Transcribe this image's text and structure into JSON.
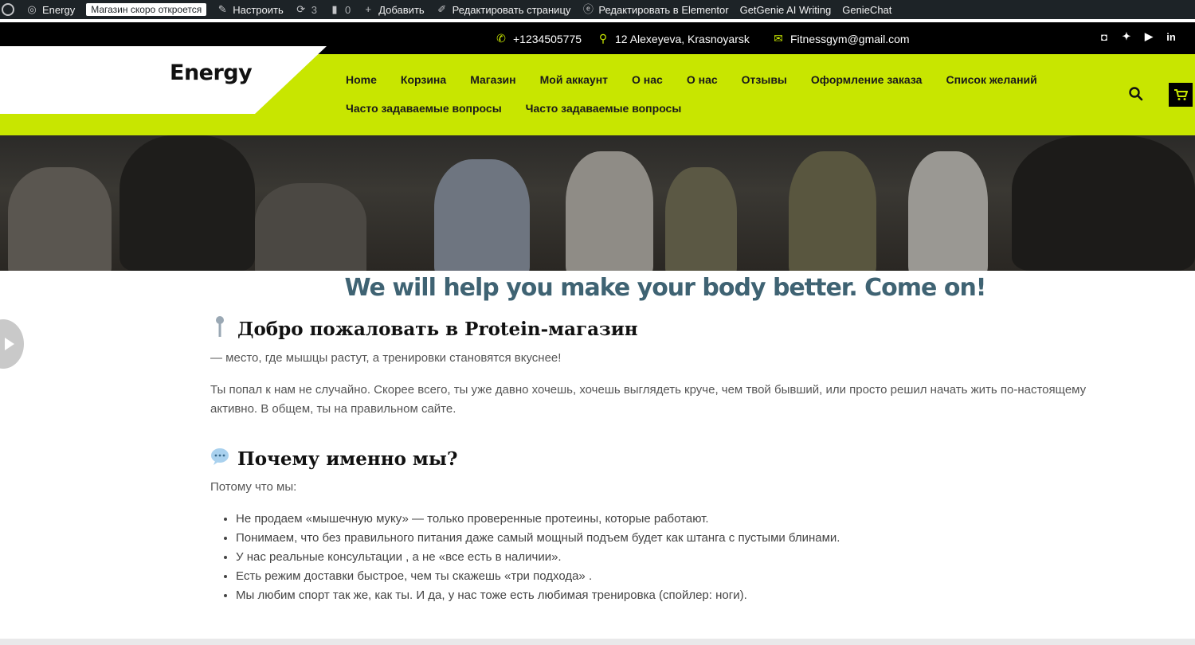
{
  "admin_bar": {
    "site_name": "Energy",
    "badge": "Магазин скоро откроется",
    "customize": "Настроить",
    "updates_count": "3",
    "comments_count": "0",
    "add_new": "Добавить",
    "edit_page": "Редактировать страницу",
    "elementor": "Редактировать в Elementor",
    "getgenie": "GetGenie AI Writing",
    "genie_chat": "GenieChat"
  },
  "top_bar": {
    "phone": "+1234505775",
    "address": "12 Alexeyeva, Krasnoyarsk",
    "email": "Fitnessgym@gmail.com"
  },
  "header": {
    "logo": "Energy",
    "nav": [
      "Home",
      "Корзина",
      "Магазин",
      "Мой аккаунт",
      "О нас",
      "О нас",
      "Отзывы",
      "Оформление заказа",
      "Список желаний",
      "Часто задаваемые вопросы",
      "Часто задаваемые вопросы"
    ]
  },
  "content": {
    "banner": "We will help you make your body better. Come on!",
    "welcome_title": "Добро пожаловать в Protein-магазин",
    "welcome_sub": "— место, где мышцы растут, а тренировки становятся вкуснее!",
    "intro": "Ты попал к нам не случайно. Скорее всего, ты уже давно хочешь, хочешь выглядеть круче, чем твой бывший, или просто решил начать жить по-настоящему активно. В общем, ты на правильном сайте.",
    "why_title": "Почему именно мы?",
    "because": "Потому что мы:",
    "bullets": [
      "Не продаем «мышечную муку» — только проверенные протеины, которые работают.",
      "Понимаем, что без правильного питания даже самый мощный подъем будет как штанга с пустыми блинами.",
      "У нас реальные консультации , а не «все есть в наличии».",
      "Есть режим доставки быстрое, чем ты скажешь «три подхода» .",
      "Мы любим спорт так же, как ты. И да, у нас тоже есть любимая тренировка (спойлер: ноги)."
    ]
  },
  "colors": {
    "accent": "#c8e600",
    "heading": "#3f6373",
    "admin_bar": "#1d2327"
  }
}
